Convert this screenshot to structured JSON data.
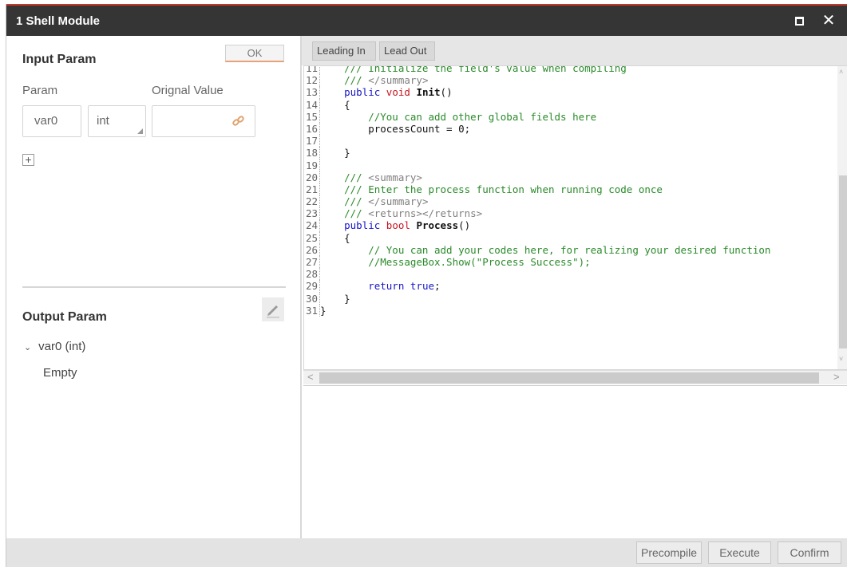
{
  "window": {
    "title": "1 Shell Module",
    "maximize_icon": "maximize-icon",
    "close_icon": "close-icon",
    "close_glyph": "✕"
  },
  "input_param": {
    "title": "Input Param",
    "ok_label": "OK",
    "col_param": "Param",
    "col_original_value": "Orignal Value",
    "row": {
      "name": "var0",
      "type": "int",
      "value": ""
    },
    "add_glyph": "+"
  },
  "output_param": {
    "title": "Output Param",
    "item": "var0 (int)",
    "item_chevron": "⌄",
    "item_value": "Empty"
  },
  "toolbar": {
    "leading_in": "Leading In",
    "lead_out": "Lead Out"
  },
  "code": [
    {
      "n": "11",
      "parts": [
        {
          "t": "    /// Initialize the field's value when compiling",
          "c": "c-comment"
        }
      ]
    },
    {
      "n": "12",
      "parts": [
        {
          "t": "    /// ",
          "c": "c-comment"
        },
        {
          "t": "</summary>",
          "c": "c-gray"
        }
      ]
    },
    {
      "n": "13",
      "parts": [
        {
          "t": "    public ",
          "c": "c-kw"
        },
        {
          "t": "void ",
          "c": "c-red"
        },
        {
          "t": "Init",
          "c": "c-bold"
        },
        {
          "t": "()",
          "c": "c-plain"
        }
      ]
    },
    {
      "n": "14",
      "parts": [
        {
          "t": "    {",
          "c": "c-plain"
        }
      ]
    },
    {
      "n": "15",
      "parts": [
        {
          "t": "        //You can add other global fields here",
          "c": "c-comment"
        }
      ]
    },
    {
      "n": "16",
      "parts": [
        {
          "t": "        processCount = 0;",
          "c": "c-plain"
        }
      ]
    },
    {
      "n": "17",
      "parts": [
        {
          "t": "",
          "c": "c-plain"
        }
      ]
    },
    {
      "n": "18",
      "parts": [
        {
          "t": "    }",
          "c": "c-plain"
        }
      ]
    },
    {
      "n": "19",
      "parts": [
        {
          "t": "",
          "c": "c-plain"
        }
      ]
    },
    {
      "n": "20",
      "parts": [
        {
          "t": "    /// ",
          "c": "c-comment"
        },
        {
          "t": "<summary>",
          "c": "c-gray"
        }
      ]
    },
    {
      "n": "21",
      "parts": [
        {
          "t": "    /// Enter the process function when running code once",
          "c": "c-comment"
        }
      ]
    },
    {
      "n": "22",
      "parts": [
        {
          "t": "    /// ",
          "c": "c-comment"
        },
        {
          "t": "</summary>",
          "c": "c-gray"
        }
      ]
    },
    {
      "n": "23",
      "parts": [
        {
          "t": "    /// ",
          "c": "c-comment"
        },
        {
          "t": "<returns></returns>",
          "c": "c-gray"
        }
      ]
    },
    {
      "n": "24",
      "parts": [
        {
          "t": "    public ",
          "c": "c-kw"
        },
        {
          "t": "bool ",
          "c": "c-red"
        },
        {
          "t": "Process",
          "c": "c-bold"
        },
        {
          "t": "()",
          "c": "c-plain"
        }
      ]
    },
    {
      "n": "25",
      "parts": [
        {
          "t": "    {",
          "c": "c-plain"
        }
      ]
    },
    {
      "n": "26",
      "parts": [
        {
          "t": "        // You can add your codes here, for realizing your desired function",
          "c": "c-comment"
        }
      ]
    },
    {
      "n": "27",
      "parts": [
        {
          "t": "        //MessageBox.Show(\"Process Success\");",
          "c": "c-comment"
        }
      ]
    },
    {
      "n": "28",
      "parts": [
        {
          "t": "",
          "c": "c-plain"
        }
      ]
    },
    {
      "n": "29",
      "parts": [
        {
          "t": "        return ",
          "c": "c-kw"
        },
        {
          "t": "true",
          "c": "c-kw"
        },
        {
          "t": ";",
          "c": "c-plain"
        }
      ]
    },
    {
      "n": "30",
      "parts": [
        {
          "t": "    }",
          "c": "c-plain"
        }
      ]
    },
    {
      "n": "31",
      "parts": [
        {
          "t": "}",
          "c": "c-plain"
        }
      ]
    }
  ],
  "scroll": {
    "up": "˄",
    "down": "˅",
    "left": "<",
    "right": ">"
  },
  "footer": {
    "precompile": "Precompile",
    "execute": "Execute",
    "confirm": "Confirm"
  }
}
